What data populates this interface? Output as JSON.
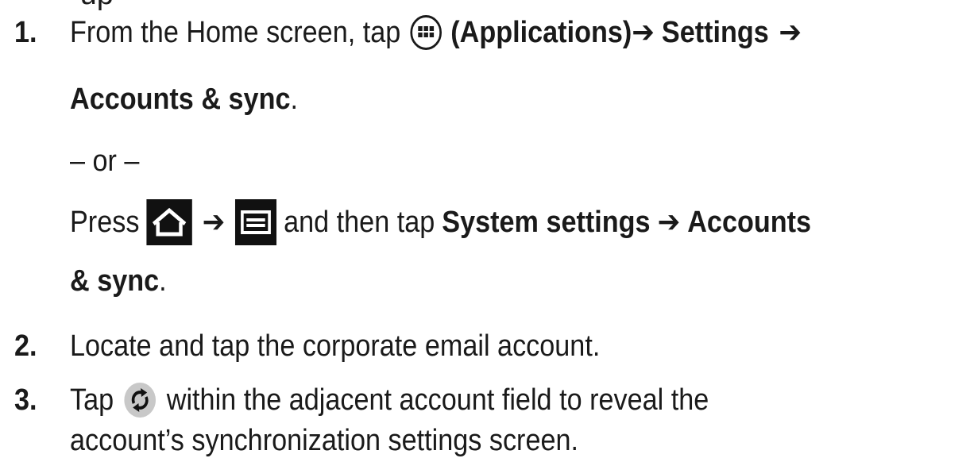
{
  "top_fragment": "-up",
  "steps": [
    {
      "number": "1.",
      "line1": {
        "text_a": "From the Home screen, tap",
        "bold_a": "(Applications)",
        "arrow1": "➔",
        "bold_b": "Settings",
        "arrow2": "➔"
      },
      "line2": {
        "bold": "Accounts & sync",
        "end": "."
      },
      "or": "– or –",
      "line4": {
        "text_a": "Press",
        "arrow": "➔",
        "text_b": "and then tap",
        "bold_a": "System settings",
        "arrow2": "➔",
        "bold_b": "Accounts"
      },
      "line5": {
        "bold": "& sync",
        "end": "."
      }
    },
    {
      "number": "2.",
      "text": "Locate and tap the corporate email account."
    },
    {
      "number": "3.",
      "line1": {
        "text_a": "Tap",
        "text_b": "within the adjacent account field to reveal the"
      },
      "line2": "account’s synchronization settings screen."
    }
  ],
  "icons": {
    "applications": "applications-grid-icon",
    "home": "home-key-icon",
    "menu": "menu-key-icon",
    "sync": "sync-icon"
  },
  "colors": {
    "text": "#1a1a1a",
    "key_background": "#111111",
    "sync_circle": "#c8c8c8"
  }
}
